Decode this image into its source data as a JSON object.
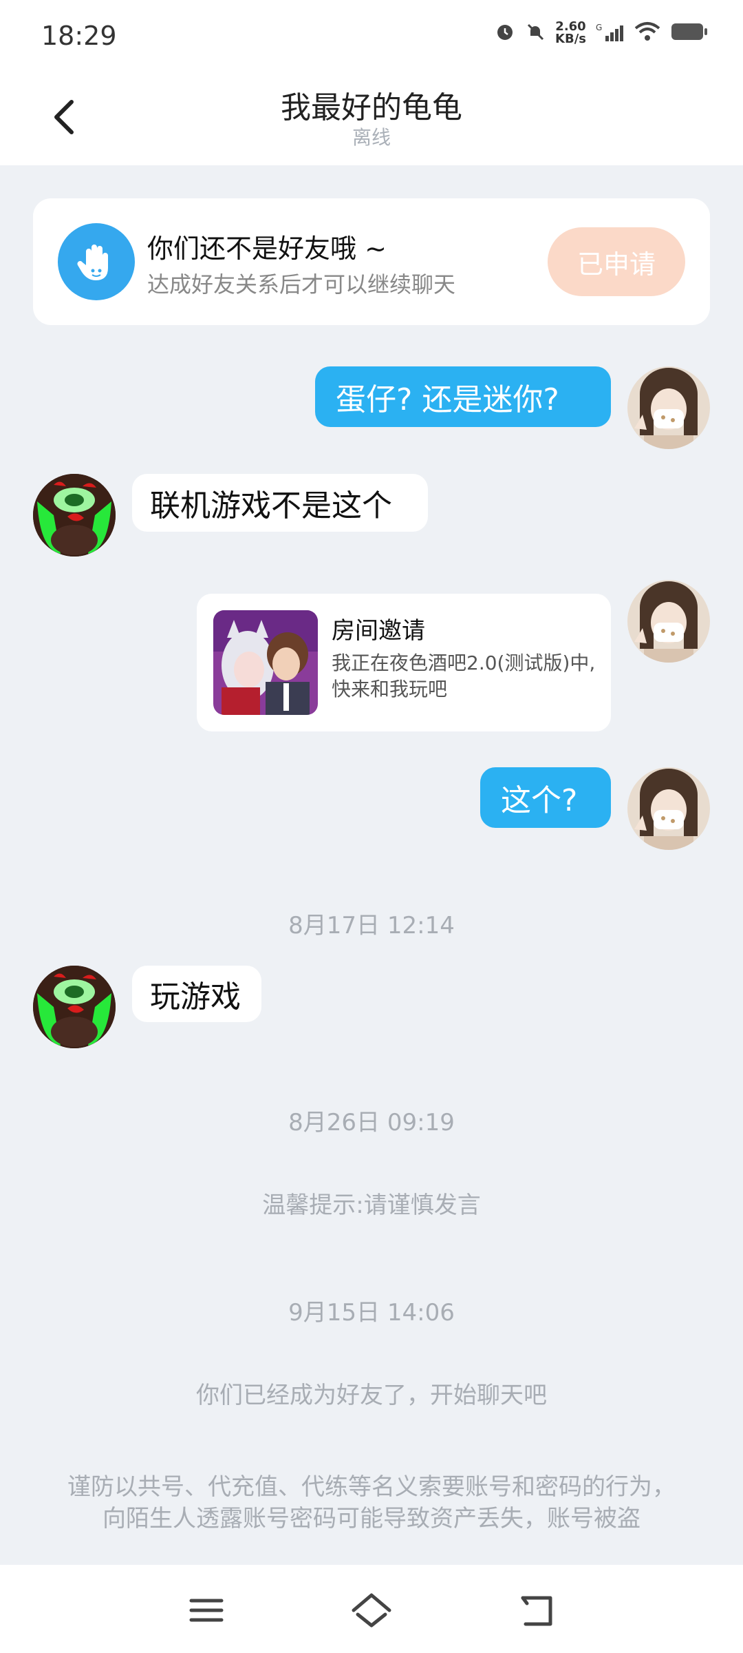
{
  "status_bar": {
    "time": "18:29",
    "speed_value": "2.60",
    "speed_unit": "KB/s",
    "network": "G"
  },
  "header": {
    "title": "我最好的龟龟",
    "subtitle": "离线"
  },
  "friend_notice": {
    "title": "你们还不是好友哦 ~",
    "subtitle": "达成好友关系后才可以继续聊天",
    "button_label": "已申请"
  },
  "messages": [
    {
      "side": "right",
      "text": "蛋仔? 还是迷你?"
    },
    {
      "side": "left",
      "text": "联机游戏不是这个"
    },
    {
      "side": "right",
      "type": "invite",
      "title": "房间邀请",
      "desc": "我正在夜色酒吧2.0(测试版)中, 快来和我玩吧"
    },
    {
      "side": "right",
      "text": "这个?"
    },
    {
      "side": "left",
      "text": "玩游戏"
    }
  ],
  "timestamps": [
    "8月17日 12:14",
    "8月26日 09:19",
    "9月15日 14:06"
  ],
  "system": {
    "tip": "温馨提示:请谨慎发言",
    "friends_now": "你们已经成为好友了，开始聊天吧",
    "warning_line1": "谨防以共号、代充值、代练等名义索要账号和密码的行为，",
    "warning_line2": "向陌生人透露账号密码可能导致资产丢失，账号被盗"
  },
  "colors": {
    "accent_blue": "#2bb1f2",
    "applied_button": "#fbd9c8",
    "background": "#eef1f5"
  },
  "icons": [
    "back-icon",
    "hand-icon",
    "alarm-icon",
    "mute-icon",
    "signal-icon",
    "wifi-icon",
    "battery-icon",
    "menu-icon",
    "home-icon",
    "back-nav-icon"
  ]
}
